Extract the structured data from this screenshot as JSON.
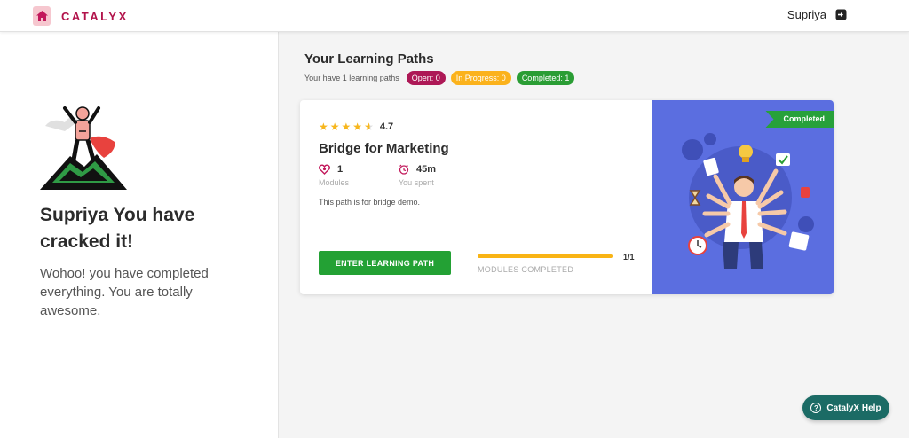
{
  "header": {
    "brand_name": "CATALYX",
    "user_name": "Supriya",
    "colors": {
      "brand": "#b2134b"
    }
  },
  "left_panel": {
    "title": "Supriya You have cracked it!",
    "message": "Wohoo! you have completed everything. You are totally awesome."
  },
  "main": {
    "section_title": "Your Learning Paths",
    "summary_text": "Your have 1 learning paths",
    "badges": {
      "open": "Open: 0",
      "in_progress": "In Progress: 0",
      "completed": "Completed: 1"
    },
    "card": {
      "rating": "4.7",
      "rating_value": 4.7,
      "title": "Bridge for Marketing",
      "modules_value": "1",
      "modules_label": "Modules",
      "time_value": "45m",
      "time_label": "You spent",
      "description": "This path is for bridge demo.",
      "enter_button": "ENTER LEARNING PATH",
      "progress_count": "1/1",
      "progress_fraction": 1.0,
      "progress_label": "MODULES COMPLETED",
      "status_ribbon": "Completed"
    }
  },
  "help": {
    "label": "CatalyX Help"
  },
  "icons": [
    "home-icon",
    "logout-icon",
    "trophy-illustration",
    "star-icon",
    "modules-icon",
    "clock-icon",
    "multitask-illustration",
    "help-icon"
  ]
}
